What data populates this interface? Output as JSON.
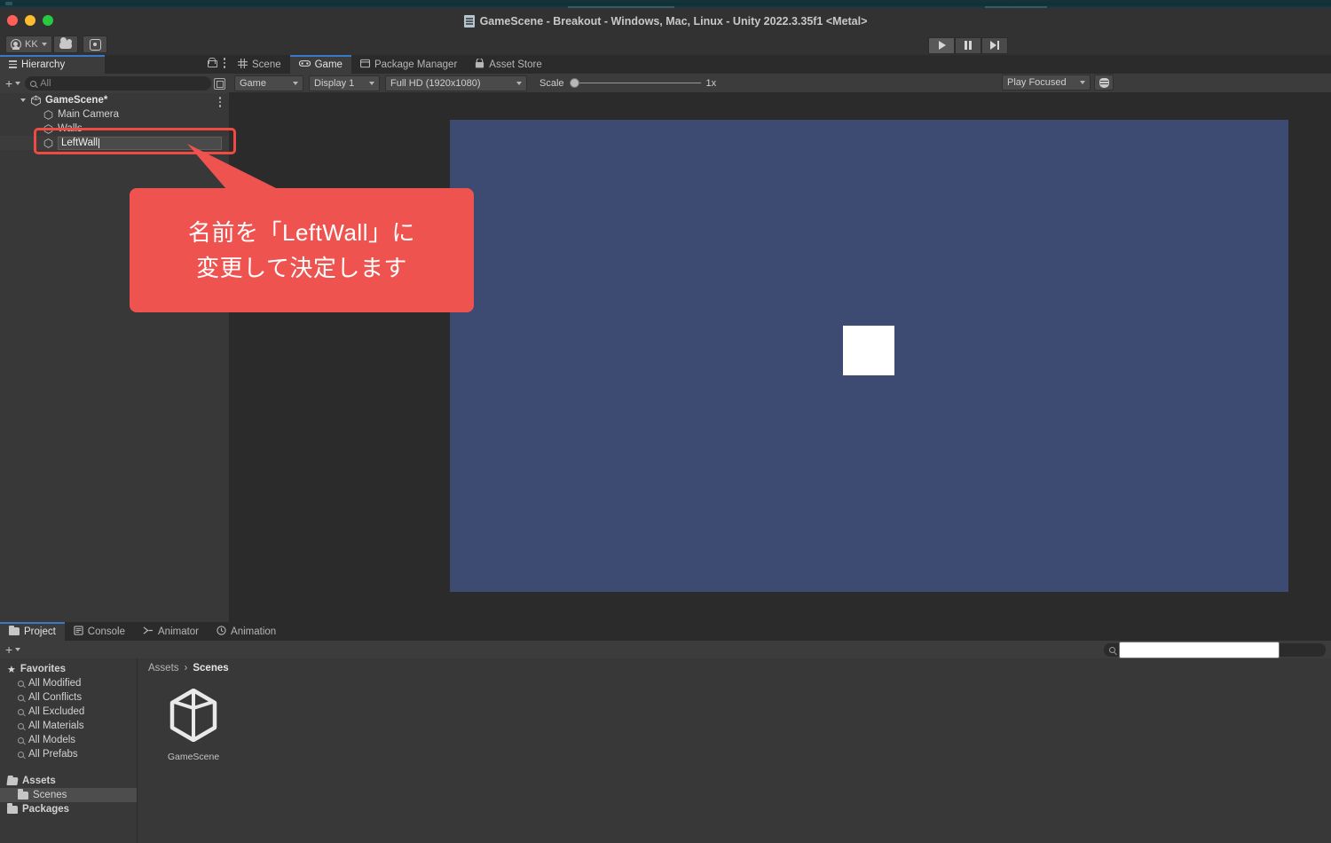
{
  "window": {
    "title": "GameScene - Breakout - Windows, Mac, Linux - Unity 2022.3.35f1 <Metal>",
    "title_icon": "scene-doc-icon",
    "traffic_lights": [
      "close-red",
      "minimize-yellow",
      "zoom-green"
    ]
  },
  "toolbar": {
    "account_label": "KK",
    "account_icon": "person-icon",
    "cloud_icon": "cloud-icon",
    "settings_icon": "gear-icon",
    "play_icon": "play-icon",
    "pause_icon": "pause-icon",
    "step_icon": "step-icon"
  },
  "hierarchy": {
    "tab_label": "Hierarchy",
    "tab_icon": "hamburger-icon",
    "lock_icon": "lock-icon",
    "menu_icon": "kebab-menu-icon",
    "add_label": "+",
    "search_placeholder": "All",
    "search_value": "",
    "search_icon": "search-icon",
    "panel_icon": "panel-toggle-icon",
    "rows": [
      {
        "label": "GameScene*",
        "depth": 0,
        "icon": "unity-scene-icon",
        "expanded": true,
        "bold": true,
        "has_menu": true
      },
      {
        "label": "Main Camera",
        "depth": 1,
        "icon": "gameobject-cube-icon",
        "bold": false
      },
      {
        "label": "Walls",
        "depth": 1,
        "icon": "gameobject-cube-icon",
        "bold": false
      },
      {
        "label": "LeftWall",
        "depth": 1,
        "icon": "gameobject-cube-icon",
        "bold": false,
        "renaming": true
      }
    ],
    "rename_value": "LeftWall"
  },
  "gameview": {
    "tabs": [
      {
        "label": "Scene",
        "icon": "grid-icon",
        "active": false
      },
      {
        "label": "Game",
        "icon": "gamepad-icon",
        "active": true
      },
      {
        "label": "Package Manager",
        "icon": "package-icon",
        "active": false
      },
      {
        "label": "Asset Store",
        "icon": "store-icon",
        "active": false
      }
    ],
    "target_display_dropdown": "Game",
    "display_dropdown": "Display 1",
    "resolution_dropdown": "Full HD (1920x1080)",
    "scale_label": "Scale",
    "scale_value": "1x",
    "scale_slider_pct": 0,
    "play_mode_dropdown": "Play Focused",
    "stats_icon": "stats-bug-icon",
    "background_color": "#3d4b72",
    "sprite_color": "#ffffff"
  },
  "project": {
    "tabs": [
      {
        "label": "Project",
        "icon": "folder-icon",
        "active": true
      },
      {
        "label": "Console",
        "icon": "console-icon",
        "active": false
      },
      {
        "label": "Animator",
        "icon": "animator-icon",
        "active": false
      },
      {
        "label": "Animation",
        "icon": "animation-clock-icon",
        "active": false
      }
    ],
    "add_label": "+",
    "search_placeholder": "",
    "search_value": "",
    "search_icon": "search-icon",
    "tree": [
      {
        "label": "Favorites",
        "icon": "star-icon",
        "bold": true,
        "depth": 0
      },
      {
        "label": "All Modified",
        "icon": "search-icon",
        "bold": false,
        "depth": 1
      },
      {
        "label": "All Conflicts",
        "icon": "search-icon",
        "bold": false,
        "depth": 1
      },
      {
        "label": "All Excluded",
        "icon": "search-icon",
        "bold": false,
        "depth": 1
      },
      {
        "label": "All Materials",
        "icon": "search-icon",
        "bold": false,
        "depth": 1
      },
      {
        "label": "All Models",
        "icon": "search-icon",
        "bold": false,
        "depth": 1
      },
      {
        "label": "All Prefabs",
        "icon": "search-icon",
        "bold": false,
        "depth": 1
      },
      {
        "label": "Assets",
        "icon": "folder-open-icon",
        "bold": true,
        "depth": 0,
        "spacer_before": true
      },
      {
        "label": "Scenes",
        "icon": "folder-icon",
        "bold": false,
        "depth": 1,
        "selected": true
      },
      {
        "label": "Packages",
        "icon": "folder-icon",
        "bold": true,
        "depth": 0
      }
    ],
    "breadcrumb": [
      "Assets",
      "Scenes"
    ],
    "assets": [
      {
        "label": "GameScene",
        "icon": "unity-scene-asset-icon"
      }
    ]
  },
  "annotation": {
    "text_line1": "名前を「LeftWall」に",
    "text_line2": "変更して決定します",
    "color": "#ef5350",
    "highlight_color": "#ef4b43"
  }
}
